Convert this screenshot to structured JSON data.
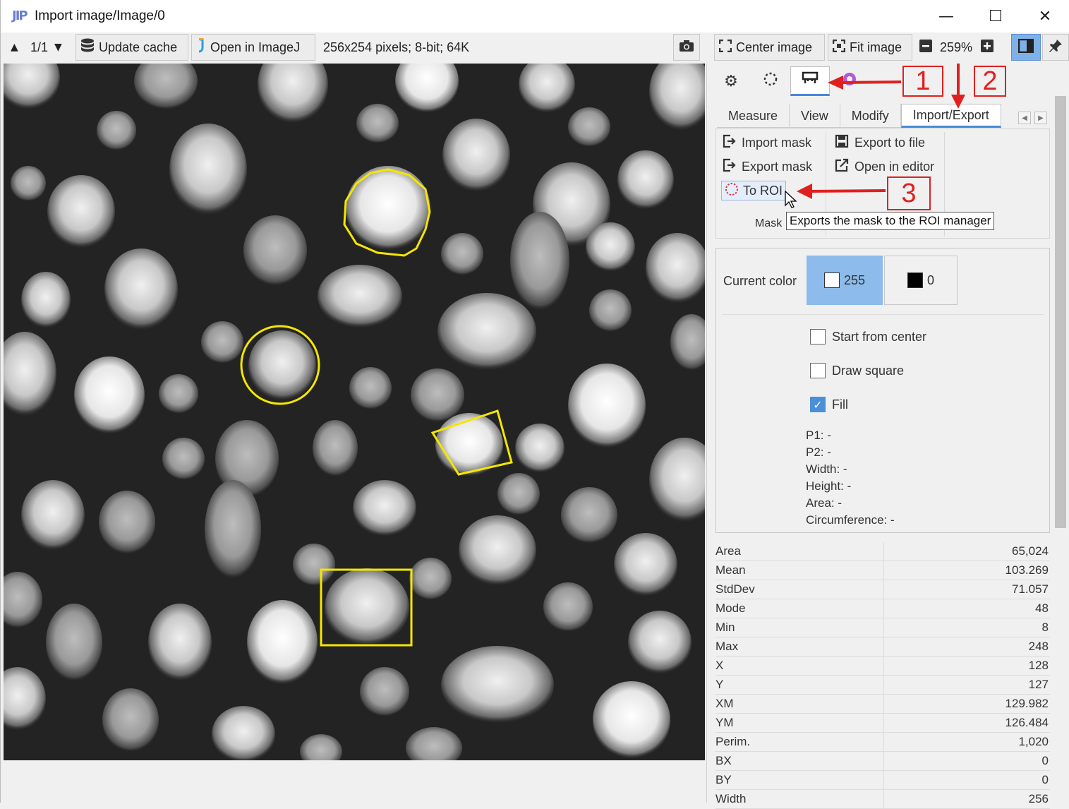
{
  "window": {
    "title": "Import image/Image/0",
    "logo": "JIP"
  },
  "toolbar": {
    "page_indicator": "1/1",
    "update_cache_label": "Update cache",
    "open_imagej_label": "Open in ImageJ",
    "image_info": "256x254 pixels; 8-bit; 64K",
    "center_image_label": "Center image",
    "fit_image_label": "Fit image",
    "zoom": "259%"
  },
  "side": {
    "text_tabs": [
      "Measure",
      "View",
      "Modify",
      "Import/Export"
    ],
    "ribbon": {
      "import_mask": "Import mask",
      "export_mask": "Export mask",
      "to_roi": "To ROI",
      "export_to_file": "Export to file",
      "open_in_editor": "Open in editor",
      "group_label": "Mask",
      "tooltip": "Exports the mask to the ROI manager"
    },
    "tool": {
      "current_color_label": "Current color",
      "color_primary": "255",
      "color_secondary": "0",
      "start_from_center": "Start from center",
      "draw_square": "Draw square",
      "fill": "Fill",
      "fill_checked": true,
      "p1": "P1: -",
      "p2": "P2: -",
      "width": "Width: -",
      "height": "Height: -",
      "area": "Area: -",
      "circumference": "Circumference: -"
    },
    "stats": [
      {
        "key": "Area",
        "value": "65,024"
      },
      {
        "key": "Mean",
        "value": "103.269"
      },
      {
        "key": "StdDev",
        "value": "71.057"
      },
      {
        "key": "Mode",
        "value": "48"
      },
      {
        "key": "Min",
        "value": "8"
      },
      {
        "key": "Max",
        "value": "248"
      },
      {
        "key": "X",
        "value": "128"
      },
      {
        "key": "Y",
        "value": "127"
      },
      {
        "key": "XM",
        "value": "129.982"
      },
      {
        "key": "YM",
        "value": "126.484"
      },
      {
        "key": "Perim.",
        "value": "1,020"
      },
      {
        "key": "BX",
        "value": "0"
      },
      {
        "key": "BY",
        "value": "0"
      },
      {
        "key": "Width",
        "value": "256"
      }
    ]
  },
  "annotations": [
    "1",
    "2",
    "3"
  ],
  "colors": {
    "roi_outline": "#f5e600",
    "annotation_red": "#e02020",
    "selected_color_bg": "#8dbbeb"
  }
}
